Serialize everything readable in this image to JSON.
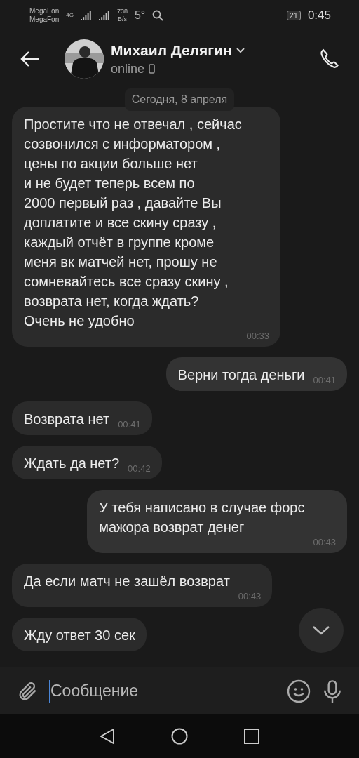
{
  "status_bar": {
    "carriers": [
      "MegaFon",
      "MegaFon"
    ],
    "network": "4G",
    "speed_value": "738",
    "speed_unit": "B/s",
    "temperature": "5°",
    "battery": "21",
    "time": "0:45"
  },
  "header": {
    "name": "Михаил Делягин",
    "status": "online"
  },
  "date_chip": "Сегодня, 8 апреля",
  "messages": [
    {
      "sent": false,
      "kind": "stacked",
      "text": "Простите что не отвечал , сейчас\nсозвонился с информатором ,\nцены по акции больше нет\nи не будет теперь всем по\n2000 первый раз , давайте Вы\nдоплатите и все скину сразу ,\nкаждый отчёт в группе кроме\nменя вк матчей нет, прошу не\nсомневайтесь все сразу скину ,\nвозврата нет, когда ждать?\nОчень не удобно",
      "time": "00:33"
    },
    {
      "sent": true,
      "kind": "inline",
      "text": "Верни тогда деньги",
      "time": "00:41"
    },
    {
      "sent": false,
      "kind": "inline",
      "text": "Возврата нет",
      "time": "00:41"
    },
    {
      "sent": false,
      "kind": "inline",
      "text": "Ждать да нет?",
      "time": "00:42"
    },
    {
      "sent": true,
      "kind": "stacked",
      "text": "У тебя написано в случае форс\nмажора возврат денег",
      "time": "00:43"
    },
    {
      "sent": false,
      "kind": "stacked",
      "text": "Да если матч не зашёл возврат",
      "time": "00:43"
    },
    {
      "sent": false,
      "kind": "inline",
      "text": "Жду ответ 30 сек"
    }
  ],
  "composer": {
    "placeholder": "Сообщение"
  }
}
